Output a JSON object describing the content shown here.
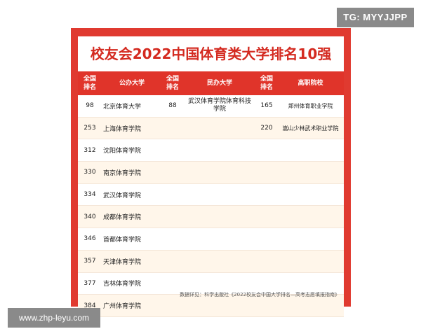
{
  "watermarks": {
    "top_right": "TG: MYYJJPP",
    "bottom_left": "www.zhp-leyu.com"
  },
  "title": "校友会2022中国体育类大学排名10强",
  "header": {
    "rank1_line1": "全国",
    "rank1_line2": "排名",
    "col_public": "公办大学",
    "rank2_line1": "全国",
    "rank2_line2": "排名",
    "col_private": "民办大学",
    "rank3_line1": "全国",
    "rank3_line2": "排名",
    "col_vocational": "高职院校"
  },
  "rows": [
    {
      "r1": "98",
      "pub": "北京体育大学",
      "r2": "88",
      "priv_line1": "武汉体育学院体育科技",
      "priv_line2": "学院",
      "r3": "165",
      "voc": "郑州体育职业学院"
    },
    {
      "r1": "253",
      "pub": "上海体育学院",
      "r2": "",
      "priv_line1": "",
      "priv_line2": "",
      "r3": "220",
      "voc": "嵩山少林武术职业学院"
    },
    {
      "r1": "312",
      "pub": "沈阳体育学院",
      "r2": "",
      "priv_line1": "",
      "priv_line2": "",
      "r3": "",
      "voc": ""
    },
    {
      "r1": "330",
      "pub": "南京体育学院",
      "r2": "",
      "priv_line1": "",
      "priv_line2": "",
      "r3": "",
      "voc": ""
    },
    {
      "r1": "334",
      "pub": "武汉体育学院",
      "r2": "",
      "priv_line1": "",
      "priv_line2": "",
      "r3": "",
      "voc": ""
    },
    {
      "r1": "340",
      "pub": "成都体育学院",
      "r2": "",
      "priv_line1": "",
      "priv_line2": "",
      "r3": "",
      "voc": ""
    },
    {
      "r1": "346",
      "pub": "首都体育学院",
      "r2": "",
      "priv_line1": "",
      "priv_line2": "",
      "r3": "",
      "voc": ""
    },
    {
      "r1": "357",
      "pub": "天津体育学院",
      "r2": "",
      "priv_line1": "",
      "priv_line2": "",
      "r3": "",
      "voc": ""
    },
    {
      "r1": "377",
      "pub": "吉林体育学院",
      "r2": "",
      "priv_line1": "",
      "priv_line2": "",
      "r3": "",
      "voc": ""
    },
    {
      "r1": "384",
      "pub": "广州体育学院",
      "r2": "",
      "priv_line1": "",
      "priv_line2": "",
      "r3": "",
      "voc": ""
    }
  ],
  "source": "数据详见：科学出版社《2022校友会中国大学排名—高考志愿填报指南》",
  "colors": {
    "accent": "#e03a30",
    "title": "#d42a20"
  }
}
